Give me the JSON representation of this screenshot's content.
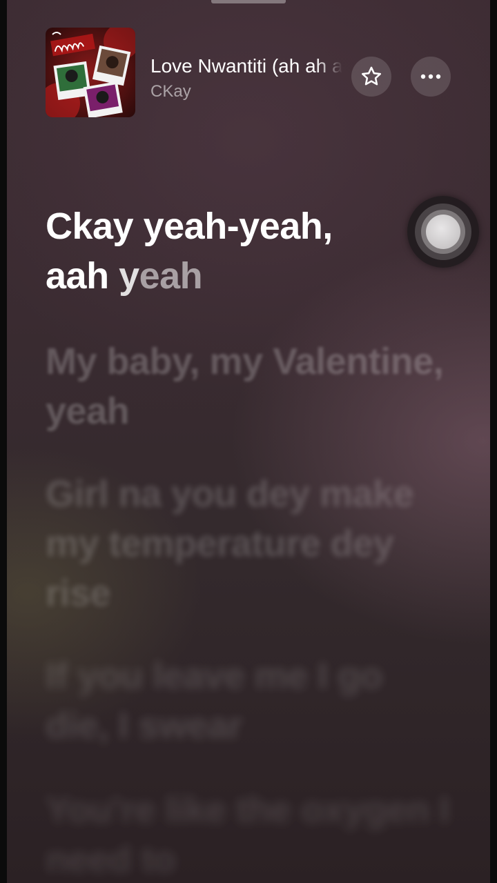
{
  "now_playing": {
    "title": "Love Nwantiti (ah ah ah)",
    "artist": "CKay",
    "artwork_icon": "album-artwork"
  },
  "header_buttons": {
    "favorite_icon": "star-icon",
    "more_icon": "ellipsis-icon"
  },
  "lyrics": {
    "active_line": {
      "line1": "Ckay yeah-yeah,",
      "part_a": "aah ",
      "part_b": "y",
      "part_c": "eah"
    },
    "upcoming": [
      "My baby, my Valentine, yeah",
      "Girl na you dey make my temperature dey rise",
      "If you leave me I go die, I swear",
      "You're like the oxygen I need to"
    ]
  },
  "assistive_touch_icon": "assistive-touch-icon"
}
